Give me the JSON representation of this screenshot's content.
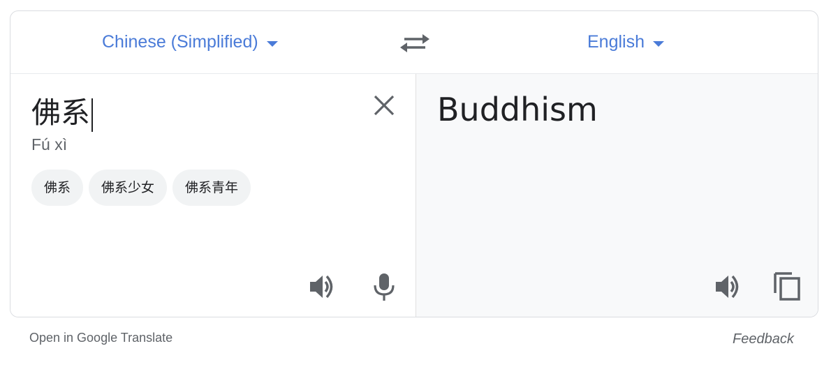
{
  "source_language": {
    "label": "Chinese (Simplified)"
  },
  "target_language": {
    "label": "English"
  },
  "swap": {
    "icon": "swap-icon"
  },
  "source": {
    "text": "佛系",
    "transliteration": "Fú xì",
    "suggestions": [
      "佛系",
      "佛系少女",
      "佛系青年"
    ],
    "icons": [
      "close-icon",
      "speaker-icon",
      "microphone-icon"
    ]
  },
  "target": {
    "text": "Buddhism",
    "icons": [
      "speaker-icon",
      "copy-icon"
    ]
  },
  "footer": {
    "open_link": "Open in Google Translate",
    "feedback": "Feedback"
  },
  "colors": {
    "accent": "#4a7bd8",
    "icon": "#5f6368",
    "target_panel_bg": "#f8f9fa",
    "chip_bg": "#f1f3f4"
  }
}
